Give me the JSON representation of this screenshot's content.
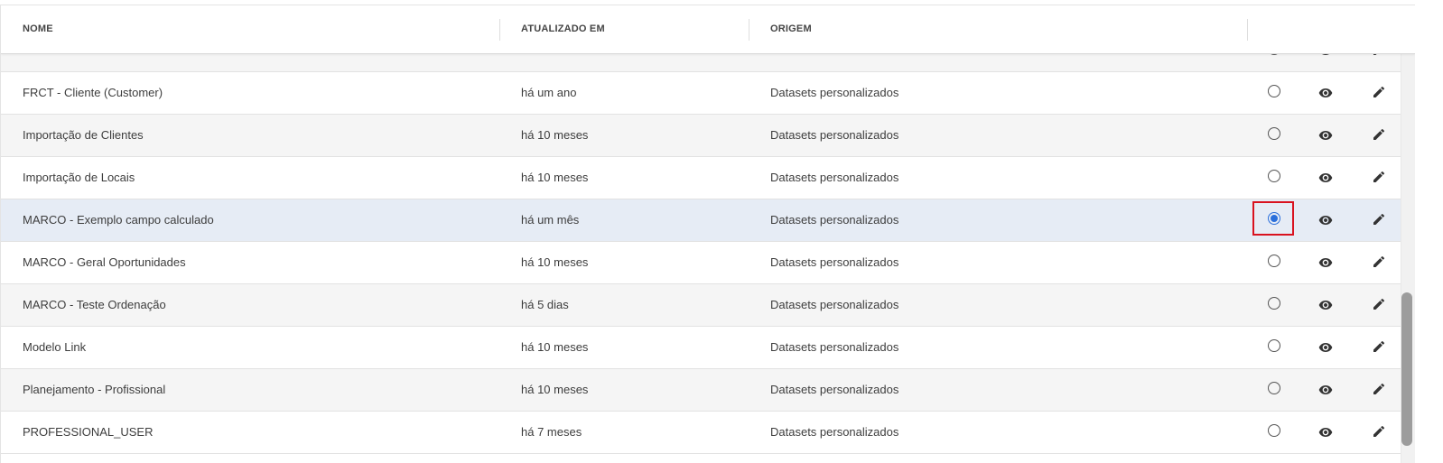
{
  "header": {
    "col_name": "NOME",
    "col_updated": "ATUALIZADO EM",
    "col_origin": "ORIGEM"
  },
  "rows": [
    {
      "name": "",
      "updated": "",
      "origin": "",
      "selected": false
    },
    {
      "name": "FRCT - Cliente (Customer)",
      "updated": "há um ano",
      "origin": "Datasets personalizados",
      "selected": false
    },
    {
      "name": "Importação de Clientes",
      "updated": "há 10 meses",
      "origin": "Datasets personalizados",
      "selected": false
    },
    {
      "name": "Importação de Locais",
      "updated": "há 10 meses",
      "origin": "Datasets personalizados",
      "selected": false
    },
    {
      "name": "MARCO - Exemplo campo calculado",
      "updated": "há um mês",
      "origin": "Datasets personalizados",
      "selected": true
    },
    {
      "name": "MARCO - Geral Oportunidades",
      "updated": "há 10 meses",
      "origin": "Datasets personalizados",
      "selected": false
    },
    {
      "name": "MARCO - Teste Ordenação",
      "updated": "há 5 dias",
      "origin": "Datasets personalizados",
      "selected": false
    },
    {
      "name": "Modelo Link",
      "updated": "há 10 meses",
      "origin": "Datasets personalizados",
      "selected": false
    },
    {
      "name": "Planejamento - Profissional",
      "updated": "há 10 meses",
      "origin": "Datasets personalizados",
      "selected": false
    },
    {
      "name": "PROFESSIONAL_USER",
      "updated": "há 7 meses",
      "origin": "Datasets personalizados",
      "selected": false
    }
  ],
  "icons": {
    "radio": "radio-button-icon",
    "view": "eye-icon",
    "edit": "pencil-icon"
  },
  "colors": {
    "selected_row": "#e6ecf5",
    "alt_row": "#f5f5f5",
    "radio_checked": "#2a6fdb",
    "highlight_box": "#d9121f",
    "icon": "#333333"
  }
}
